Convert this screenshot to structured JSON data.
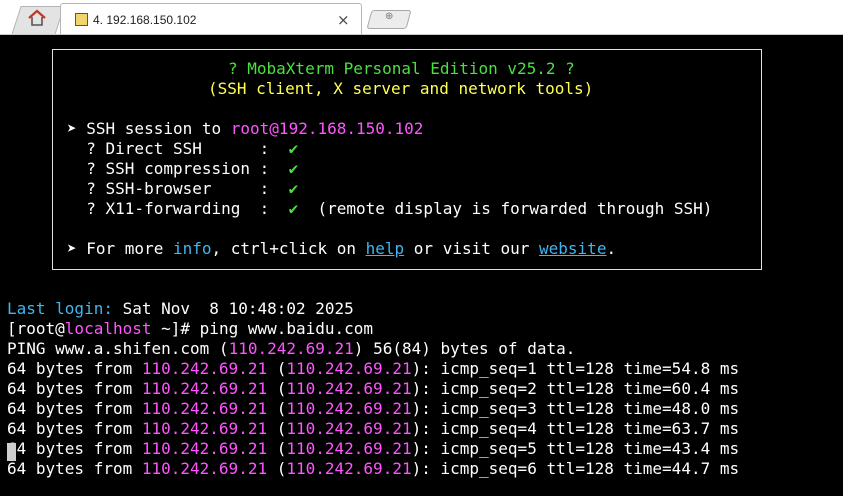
{
  "tabs": {
    "home_icon": "home-icon",
    "session_icon": "session-icon",
    "session_title": "4. 192.168.150.102",
    "close_glyph": "×",
    "new_tab_glyph": "⊕"
  },
  "banner": {
    "title": "? MobaXterm Personal Edition v25.2 ?",
    "subtitle": "(SSH client, X server and network tools)",
    "session_prefix": "➤ SSH session to ",
    "session_target": "root@192.168.150.102",
    "features": [
      {
        "label": "  ? Direct SSH      :  ",
        "check": "✔",
        "note": ""
      },
      {
        "label": "  ? SSH compression :  ",
        "check": "✔",
        "note": ""
      },
      {
        "label": "  ? SSH-browser     :  ",
        "check": "✔",
        "note": ""
      },
      {
        "label": "  ? X11-forwarding  :  ",
        "check": "✔",
        "note": "  (remote display is forwarded through SSH)"
      }
    ],
    "more": {
      "prefix": "➤ For more ",
      "info": "info",
      "mid": ", ctrl+click on ",
      "help": "help",
      "or": " or visit our ",
      "website": "website",
      "end": "."
    }
  },
  "login": {
    "label": "Last login:",
    "value": " Sat Nov  8 10:48:02 2025"
  },
  "prompt": {
    "open": "[root@",
    "host": "localhost",
    "rest": " ~]# ",
    "command": "ping www.baidu.com"
  },
  "ping_header": {
    "prefix": "PING www.a.shifen.com (",
    "ip": "110.242.69.21",
    "suffix": ") 56(84) bytes of data."
  },
  "ping_lines": [
    {
      "prefix": "64 bytes from ",
      "ip": "110.242.69.21",
      "mid": " (",
      "ip2": "110.242.69.21",
      "rest": "): icmp_seq=1 ttl=128 time=54.8 ms"
    },
    {
      "prefix": "64 bytes from ",
      "ip": "110.242.69.21",
      "mid": " (",
      "ip2": "110.242.69.21",
      "rest": "): icmp_seq=2 ttl=128 time=60.4 ms"
    },
    {
      "prefix": "64 bytes from ",
      "ip": "110.242.69.21",
      "mid": " (",
      "ip2": "110.242.69.21",
      "rest": "): icmp_seq=3 ttl=128 time=48.0 ms"
    },
    {
      "prefix": "64 bytes from ",
      "ip": "110.242.69.21",
      "mid": " (",
      "ip2": "110.242.69.21",
      "rest": "): icmp_seq=4 ttl=128 time=63.7 ms"
    },
    {
      "prefix": "64 bytes from ",
      "ip": "110.242.69.21",
      "mid": " (",
      "ip2": "110.242.69.21",
      "rest": "): icmp_seq=5 ttl=128 time=43.4 ms"
    },
    {
      "prefix": "64 bytes from ",
      "ip": "110.242.69.21",
      "mid": " (",
      "ip2": "110.242.69.21",
      "rest": "): icmp_seq=6 ttl=128 time=44.7 ms"
    }
  ],
  "colors": {
    "green": "#4ae040",
    "yellow": "#ffff54",
    "magenta": "#ff55ff",
    "cyan": "#3fb6f0"
  }
}
